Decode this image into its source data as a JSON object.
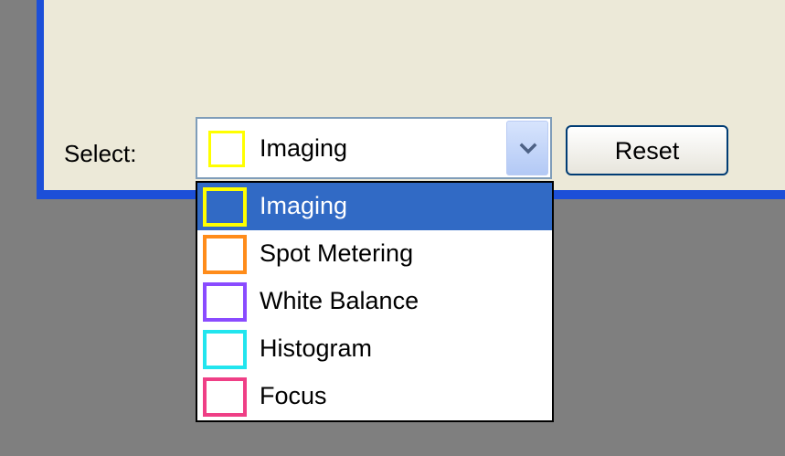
{
  "form": {
    "select_label": "Select:",
    "selected_value": "Imaging",
    "selected_color": "#ffff00",
    "reset_label": "Reset"
  },
  "dropdown": {
    "options": [
      {
        "label": "Imaging",
        "color": "#ffff00",
        "selected": true
      },
      {
        "label": "Spot Metering",
        "color": "#ff8c1a",
        "selected": false
      },
      {
        "label": "White Balance",
        "color": "#8a4bff",
        "selected": false
      },
      {
        "label": "Histogram",
        "color": "#22e5ee",
        "selected": false
      },
      {
        "label": "Focus",
        "color": "#ef3f86",
        "selected": false
      }
    ]
  },
  "colors": {
    "highlight": "#316ac5",
    "frame": "#1c4fd8",
    "panel": "#ece9d8",
    "background": "#7f7f7f"
  },
  "icons": {
    "dropdown_arrow": "chevron-down-icon"
  }
}
